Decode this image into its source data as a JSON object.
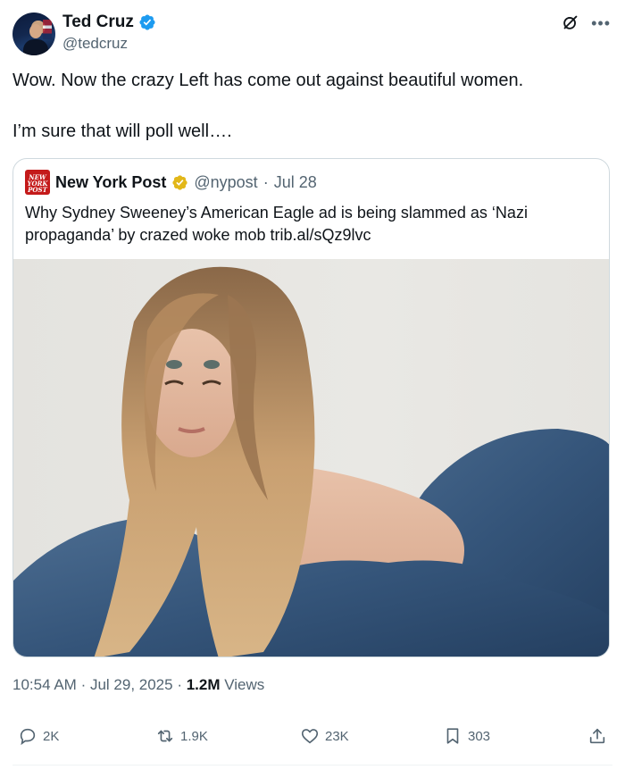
{
  "author": {
    "name": "Ted Cruz",
    "handle": "@tedcruz"
  },
  "tweet": {
    "lines": [
      "Wow. Now the crazy Left has come out against beautiful women.",
      "I’m sure that will poll well…."
    ]
  },
  "quoted": {
    "logo_text": "NEW YORK POST",
    "name": "New York Post",
    "handle": "@nypost",
    "separator": "·",
    "date": "Jul 28",
    "text_line1": "Why Sydney Sweeney’s American Eagle ad is being slammed as ‘Nazi",
    "text_line2": "propaganda’ by crazed woke mob trib.al/sQz9lvc"
  },
  "meta": {
    "time": "10:54 AM",
    "date": "Jul 29, 2025",
    "views_count": "1.2M",
    "views_label": "Views"
  },
  "actions": {
    "replies": "2K",
    "reposts": "1.9K",
    "likes": "23K",
    "bookmarks": "303"
  },
  "colors": {
    "verified_blue": "#1d9bf0",
    "verified_gold": "#e2b719",
    "text_primary": "#0f1419",
    "text_secondary": "#536471",
    "border": "#cfd9de",
    "nyp_red": "#c41a1a"
  }
}
